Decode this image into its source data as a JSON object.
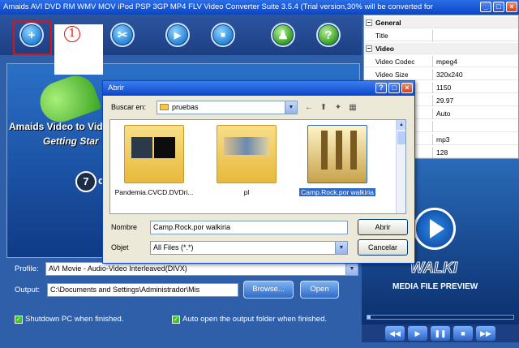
{
  "window": {
    "title": "Amaids AVI DVD RM WMV MOV iPod PSP 3GP MP4 FLV Video Converter Suite 3.5.4 (Trial version,30% will be converted for",
    "min": "_",
    "max": "□",
    "close": "×"
  },
  "toolbar": {
    "add_glyph": "+",
    "cut_glyph": "✂",
    "play_glyph": "▶",
    "stop_glyph": "■",
    "user_glyph": "♟",
    "help_glyph": "?",
    "callout_number": "1"
  },
  "preview": {
    "title": "Amaids Video to Vide",
    "subtitle": "Getting Star",
    "step_number": "7",
    "step_suffix": "c"
  },
  "profile": {
    "label": "Profile:",
    "value": "AVI Movie - Audio-Video Interleaved(DIVX)"
  },
  "output": {
    "label": "Output:",
    "value": "C:\\Documents and Settings\\Administrador\\Mis",
    "browse": "Browse...",
    "open": "Open"
  },
  "options": {
    "shutdown": "Shutdown PC when finished.",
    "auto_open": "Auto open the output folder when finished."
  },
  "properties": {
    "general_header": "General",
    "video_header": "Video",
    "rows": [
      {
        "k": "Title",
        "v": ""
      },
      {
        "k": "Video Codec",
        "v": "mpeg4"
      },
      {
        "k": "Video Size",
        "v": "320x240"
      },
      {
        "k": "",
        "v": "1150"
      },
      {
        "k": "",
        "v": "29.97"
      },
      {
        "k": "",
        "v": "Auto"
      },
      {
        "k": "",
        "v": ""
      },
      {
        "k": "c",
        "v": "mp3"
      },
      {
        "k": "",
        "v": "128"
      }
    ]
  },
  "media_preview": {
    "brand": "WALKI",
    "label": "MEDIA FILE PREVIEW",
    "progress": 0.02,
    "controls": [
      "◀◀",
      "▶",
      "❚❚",
      "■",
      "▶▶"
    ]
  },
  "dialog": {
    "title": "Abrir",
    "look_in_label": "Buscar en:",
    "look_in_value": "pruebas",
    "files": [
      {
        "name": "Pandemia.CVCD.DVDri...",
        "selected": false
      },
      {
        "name": "pl",
        "selected": false
      },
      {
        "name": "Camp.Rock.por walkiria",
        "selected": true
      }
    ],
    "name_label": "Nombre",
    "name_value": "Camp.Rock.por walkiria",
    "type_label": "Objet",
    "type_value": "All Files (*.*)",
    "open_button": "Abrir",
    "cancel_button": "Cancelar",
    "help": "?",
    "close": "×"
  }
}
